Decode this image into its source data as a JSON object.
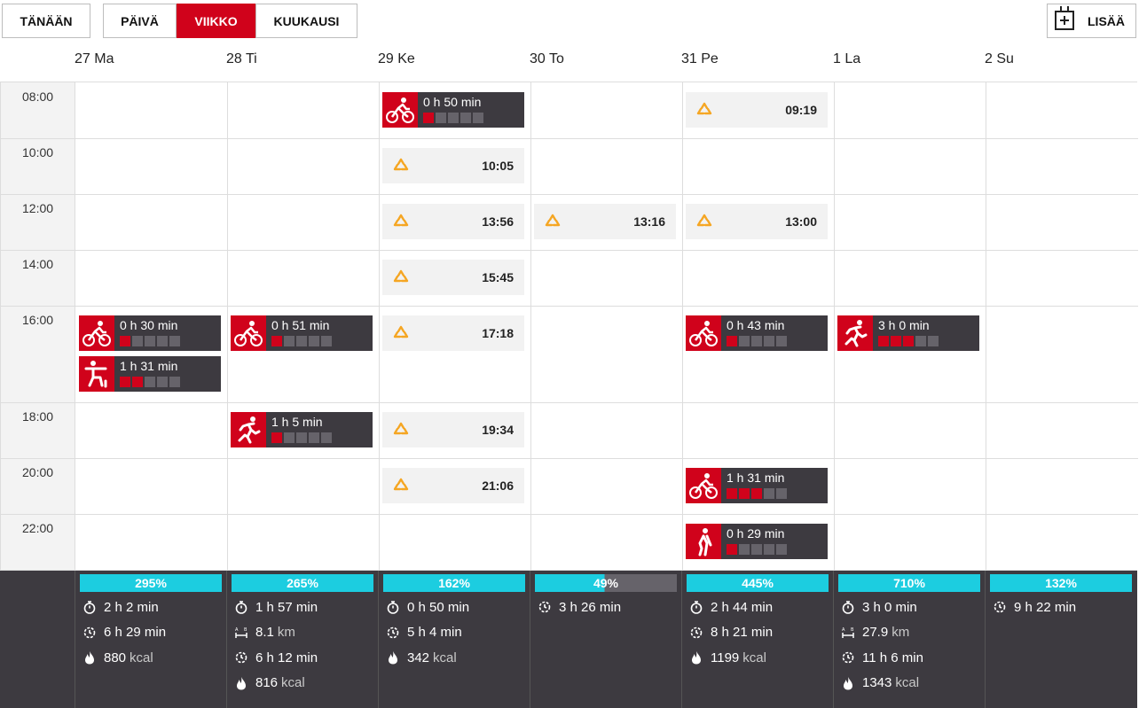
{
  "toolbar": {
    "today": "TÄNÄÄN",
    "views": [
      "PÄIVÄ",
      "VIIKKO",
      "KUUKAUSI"
    ],
    "active_view": "VIIKKO",
    "add": "LISÄÄ"
  },
  "days": [
    "27 Ma",
    "28 Ti",
    "29 Ke",
    "30 To",
    "31 Pe",
    "1 La",
    "2 Su"
  ],
  "times": [
    "08:00",
    "10:00",
    "12:00",
    "14:00",
    "16:00",
    "18:00",
    "20:00",
    "22:00"
  ],
  "workouts": [
    {
      "day": "29 Ke",
      "slot": "08:00",
      "sport": "cycling-icon",
      "duration": "0 h 50 min",
      "intensity": 1
    },
    {
      "day": "27 Ma",
      "slot": "16:00",
      "sport": "cycling-icon",
      "duration": "0 h 30 min",
      "intensity": 1
    },
    {
      "day": "27 Ma",
      "slot": "16:00",
      "sport": "strength-icon",
      "duration": "1 h 31 min",
      "intensity": 2
    },
    {
      "day": "28 Ti",
      "slot": "16:00",
      "sport": "cycling-icon",
      "duration": "0 h 51 min",
      "intensity": 1
    },
    {
      "day": "31 Pe",
      "slot": "16:00",
      "sport": "cycling-icon",
      "duration": "0 h 43 min",
      "intensity": 1
    },
    {
      "day": "1 La",
      "slot": "16:00",
      "sport": "running-icon",
      "duration": "3 h 0 min",
      "intensity": 3
    },
    {
      "day": "28 Ti",
      "slot": "18:00",
      "sport": "running-icon",
      "duration": "1 h 5 min",
      "intensity": 1
    },
    {
      "day": "31 Pe",
      "slot": "20:00",
      "sport": "cycling-icon",
      "duration": "1 h 31 min",
      "intensity": 3
    },
    {
      "day": "31 Pe",
      "slot": "22:00",
      "sport": "other-sport-icon",
      "duration": "0 h 29 min",
      "intensity": 1
    }
  ],
  "training_targets": [
    {
      "day": "31 Pe",
      "slot": "08:00",
      "time": "09:19"
    },
    {
      "day": "29 Ke",
      "slot": "10:00",
      "time": "10:05"
    },
    {
      "day": "29 Ke",
      "slot": "12:00",
      "time": "13:56"
    },
    {
      "day": "30 To",
      "slot": "12:00",
      "time": "13:16"
    },
    {
      "day": "31 Pe",
      "slot": "12:00",
      "time": "13:00"
    },
    {
      "day": "29 Ke",
      "slot": "14:00",
      "time": "15:45"
    },
    {
      "day": "29 Ke",
      "slot": "16:00",
      "time": "17:18"
    },
    {
      "day": "29 Ke",
      "slot": "18:00",
      "time": "19:34"
    },
    {
      "day": "29 Ke",
      "slot": "20:00",
      "time": "21:06"
    }
  ],
  "summary": [
    {
      "day": "27 Ma",
      "pct": "295%",
      "rows": [
        {
          "icon": "stopwatch-icon",
          "value": "2 h 2 min",
          "unit": ""
        },
        {
          "icon": "activity-time-icon",
          "value": "6 h 29 min",
          "unit": ""
        },
        {
          "icon": "flame-icon",
          "value": "880",
          "unit": "kcal"
        }
      ]
    },
    {
      "day": "28 Ti",
      "pct": "265%",
      "rows": [
        {
          "icon": "stopwatch-icon",
          "value": "1 h 57 min",
          "unit": ""
        },
        {
          "icon": "distance-icon",
          "value": "8.1",
          "unit": "km"
        },
        {
          "icon": "activity-time-icon",
          "value": "6 h 12 min",
          "unit": ""
        },
        {
          "icon": "flame-icon",
          "value": "816",
          "unit": "kcal"
        }
      ]
    },
    {
      "day": "29 Ke",
      "pct": "162%",
      "rows": [
        {
          "icon": "stopwatch-icon",
          "value": "0 h 50 min",
          "unit": ""
        },
        {
          "icon": "activity-time-icon",
          "value": "5 h 4 min",
          "unit": ""
        },
        {
          "icon": "flame-icon",
          "value": "342",
          "unit": "kcal"
        }
      ]
    },
    {
      "day": "30 To",
      "pct": "49%",
      "rows": [
        {
          "icon": "activity-time-icon",
          "value": "3 h 26 min",
          "unit": ""
        }
      ]
    },
    {
      "day": "31 Pe",
      "pct": "445%",
      "rows": [
        {
          "icon": "stopwatch-icon",
          "value": "2 h 44 min",
          "unit": ""
        },
        {
          "icon": "activity-time-icon",
          "value": "8 h 21 min",
          "unit": ""
        },
        {
          "icon": "flame-icon",
          "value": "1199",
          "unit": "kcal"
        }
      ]
    },
    {
      "day": "1 La",
      "pct": "710%",
      "rows": [
        {
          "icon": "stopwatch-icon",
          "value": "3 h 0 min",
          "unit": ""
        },
        {
          "icon": "distance-icon",
          "value": "27.9",
          "unit": "km"
        },
        {
          "icon": "activity-time-icon",
          "value": "11 h 6 min",
          "unit": ""
        },
        {
          "icon": "flame-icon",
          "value": "1343",
          "unit": "kcal"
        }
      ]
    },
    {
      "day": "2 Su",
      "pct": "132%",
      "rows": [
        {
          "icon": "activity-time-icon",
          "value": "9 h 22 min",
          "unit": ""
        }
      ]
    }
  ],
  "colors": {
    "accent": "#d0021b",
    "dark": "#3d3a40",
    "progress": "#1ccde0",
    "target": "#f5a623"
  }
}
